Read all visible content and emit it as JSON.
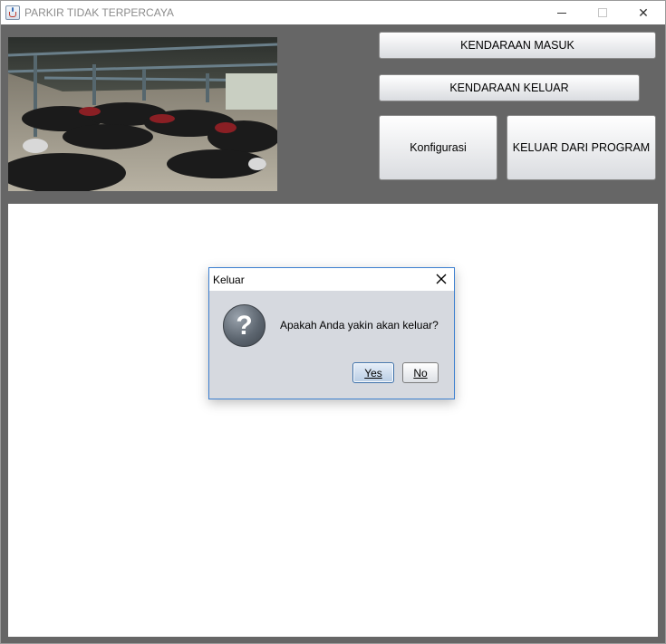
{
  "window": {
    "title": "PARKIR TIDAK TERPERCAYA",
    "icon": "java-cup-icon",
    "controls": {
      "minimize": "minimize-icon",
      "maximize": "maximize-icon",
      "close": "✕"
    }
  },
  "header": {
    "photo": "parking-lot-motorcycles-image",
    "buttons": {
      "masuk": "KENDARAAN MASUK",
      "keluar": "KENDARAAN KELUAR",
      "konfigurasi": "Konfigurasi",
      "exit": "KELUAR DARI PROGRAM"
    }
  },
  "dialog": {
    "title": "Keluar",
    "close_icon": "✕",
    "question_glyph": "?",
    "message": "Apakah Anda yakin akan keluar?",
    "yes_label": "Yes",
    "no_label": "No"
  },
  "colors": {
    "background": "#666666",
    "panel": "#ffffff",
    "dialog_bg": "#d6d9df",
    "dialog_border": "#3c7fd0"
  }
}
